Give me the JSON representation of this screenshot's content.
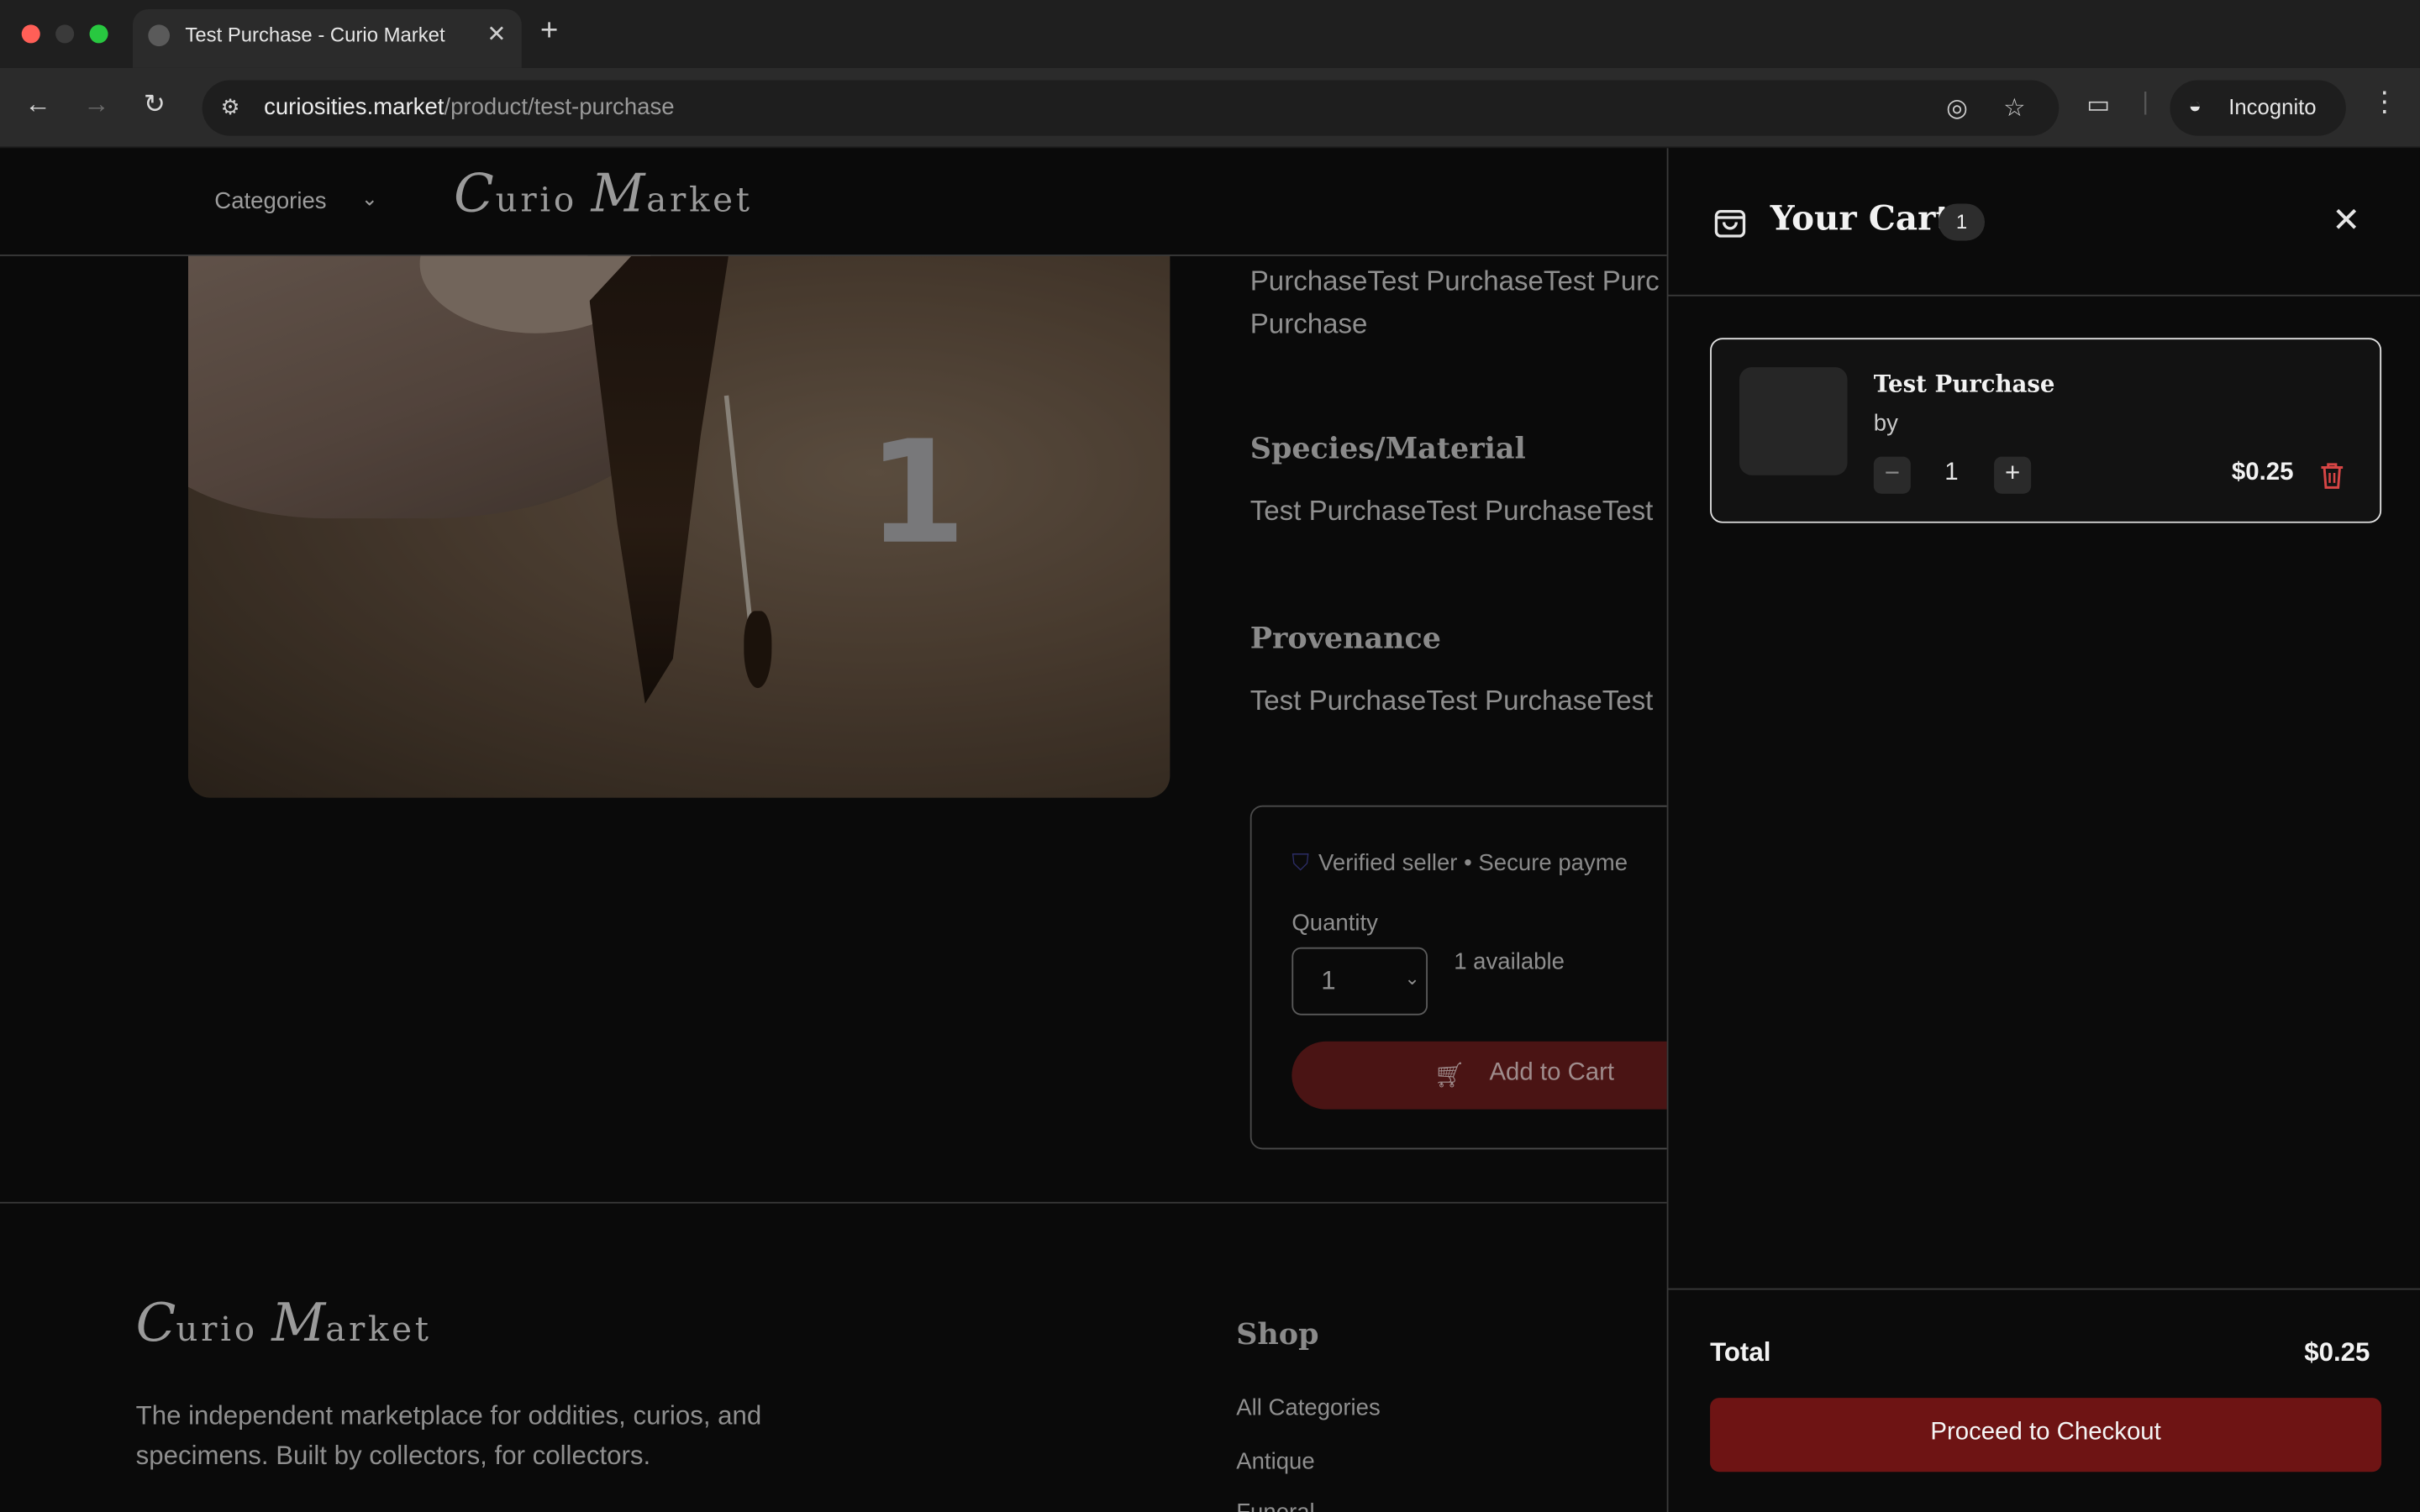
{
  "browser": {
    "tab_title": "Test Purchase - Curio Market",
    "url_host": "curiosities.market",
    "url_path": "/product/test-purchase",
    "incognito_label": "Incognito"
  },
  "header": {
    "categories_label": "Categories",
    "logo_first": "C",
    "logo_rest1": "urio ",
    "logo_second": "M",
    "logo_rest2": "arket"
  },
  "product": {
    "image_number": "1",
    "description_line1": "PurchaseTest PurchaseTest Purc",
    "description_line2": "Purchase",
    "species_heading": "Species/Material",
    "species_value": "Test PurchaseTest PurchaseTest",
    "provenance_heading": "Provenance",
    "provenance_value": "Test PurchaseTest PurchaseTest",
    "verified_text": "Verified seller • Secure payme",
    "quantity_label": "Quantity",
    "quantity_value": "1",
    "available_text": "1 available",
    "add_to_cart_label": "Add to Cart"
  },
  "footer": {
    "tagline": "The independent marketplace for oddities, curios, and specimens. Built by collectors, for collectors.",
    "shop_heading": "Shop",
    "shop_links": [
      "All Categories",
      "Antique",
      "Funeral"
    ]
  },
  "cart": {
    "title": "Your Cart",
    "count": "1",
    "item": {
      "name": "Test Purchase",
      "by": "by",
      "quantity": "1",
      "price": "$0.25"
    },
    "total_label": "Total",
    "total_value": "$0.25",
    "checkout_label": "Proceed to Checkout"
  },
  "colors": {
    "checkout": "#6e1414",
    "add_to_cart": "#4a1414",
    "trash": "#d64545"
  }
}
